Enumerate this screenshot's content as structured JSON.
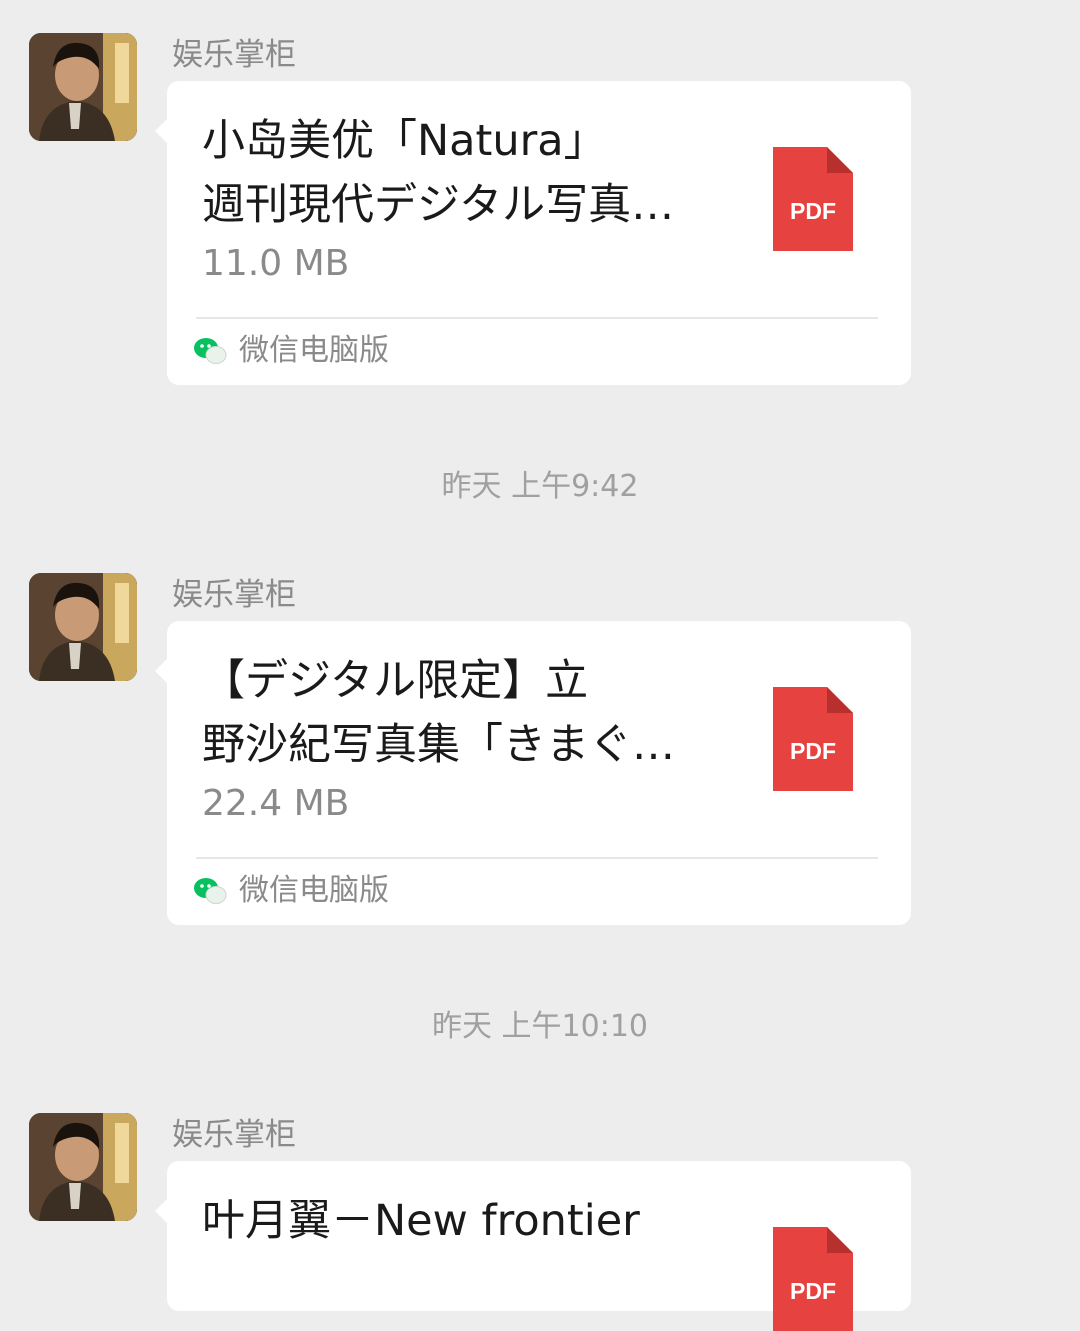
{
  "messages": [
    {
      "sender": "娱乐掌柜",
      "title_line1": "小岛美优「Natura」",
      "title_line2": "週刊現代デジタル写真…",
      "size": "11.0 MB",
      "file_type": "PDF",
      "source": "微信电脑版"
    },
    {
      "sender": "娱乐掌柜",
      "title_line1": "【デジタル限定】立",
      "title_line2": "野沙紀写真集「きまぐ…",
      "size": "22.4 MB",
      "file_type": "PDF",
      "source": "微信电脑版"
    },
    {
      "sender": "娱乐掌柜",
      "title_line1": "叶月翼－New frontier",
      "title_line2": "",
      "size": "",
      "file_type": "PDF",
      "source": ""
    }
  ],
  "timestamps": [
    "昨天 上午9:42",
    "昨天 上午10:10"
  ],
  "colors": {
    "background": "#ededed",
    "card": "#ffffff",
    "pdf_red": "#e64340",
    "wechat_green": "#07c160"
  },
  "icons": {
    "file": "pdf-file-icon",
    "source": "wechat-logo-icon"
  }
}
